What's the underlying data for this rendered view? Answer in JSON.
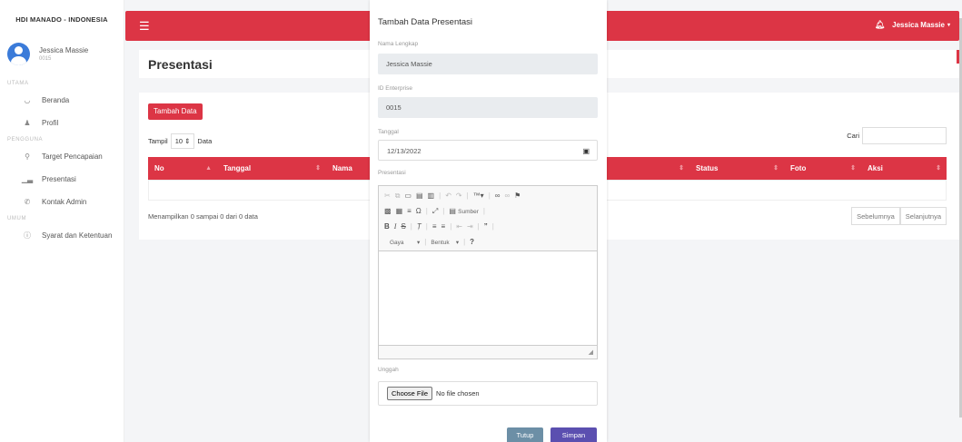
{
  "sidebar": {
    "brand": "HDI MANADO - INDONESIA",
    "user_name": "Jessica Massie",
    "user_id": "0015",
    "sections": {
      "utama": "UTAMA",
      "pengguna": "PENGGUNA",
      "umum": "UMUM"
    },
    "items": [
      {
        "icon": "home-icon",
        "label": "Beranda"
      },
      {
        "icon": "user-icon",
        "label": "Profil"
      },
      {
        "icon": "target-icon",
        "label": "Target Pencapaian"
      },
      {
        "icon": "bar-chart-icon",
        "label": "Presentasi"
      },
      {
        "icon": "phone-icon",
        "label": "Kontak Admin"
      },
      {
        "icon": "info-icon",
        "label": "Syarat dan Ketentuan"
      }
    ]
  },
  "topbar": {
    "user_name": "Jessica Massie",
    "accent_color": "#dc3545"
  },
  "page": {
    "title": "Presentasi",
    "add_button": "Tambah Data",
    "show_label": "Tampil",
    "entries_value": "10",
    "entries_suffix": "Data",
    "search_label": "Cari",
    "columns": [
      "No",
      "Tanggal",
      "Nama",
      "Status",
      "Foto",
      "Aksi"
    ],
    "info": "Menampilkan 0 sampai 0 dari 0 data",
    "prev": "Sebelumnya",
    "next": "Selanjutnya"
  },
  "modal": {
    "title": "Tambah Data Presentasi",
    "name_label": "Nama Lengkap",
    "name_value": "Jessica Massie",
    "id_label": "ID Enterprise",
    "id_value": "0015",
    "date_label": "Tanggal",
    "date_value": "12/13/2022",
    "presentation_label": "Presentasi",
    "source_label": "Sumber",
    "style_label": "Gaya",
    "format_label": "Bentuk",
    "upload_label": "Unggah",
    "file_button": "Choose File",
    "file_status": "No file chosen",
    "close_button": "Tutup",
    "save_button": "Simpan"
  }
}
